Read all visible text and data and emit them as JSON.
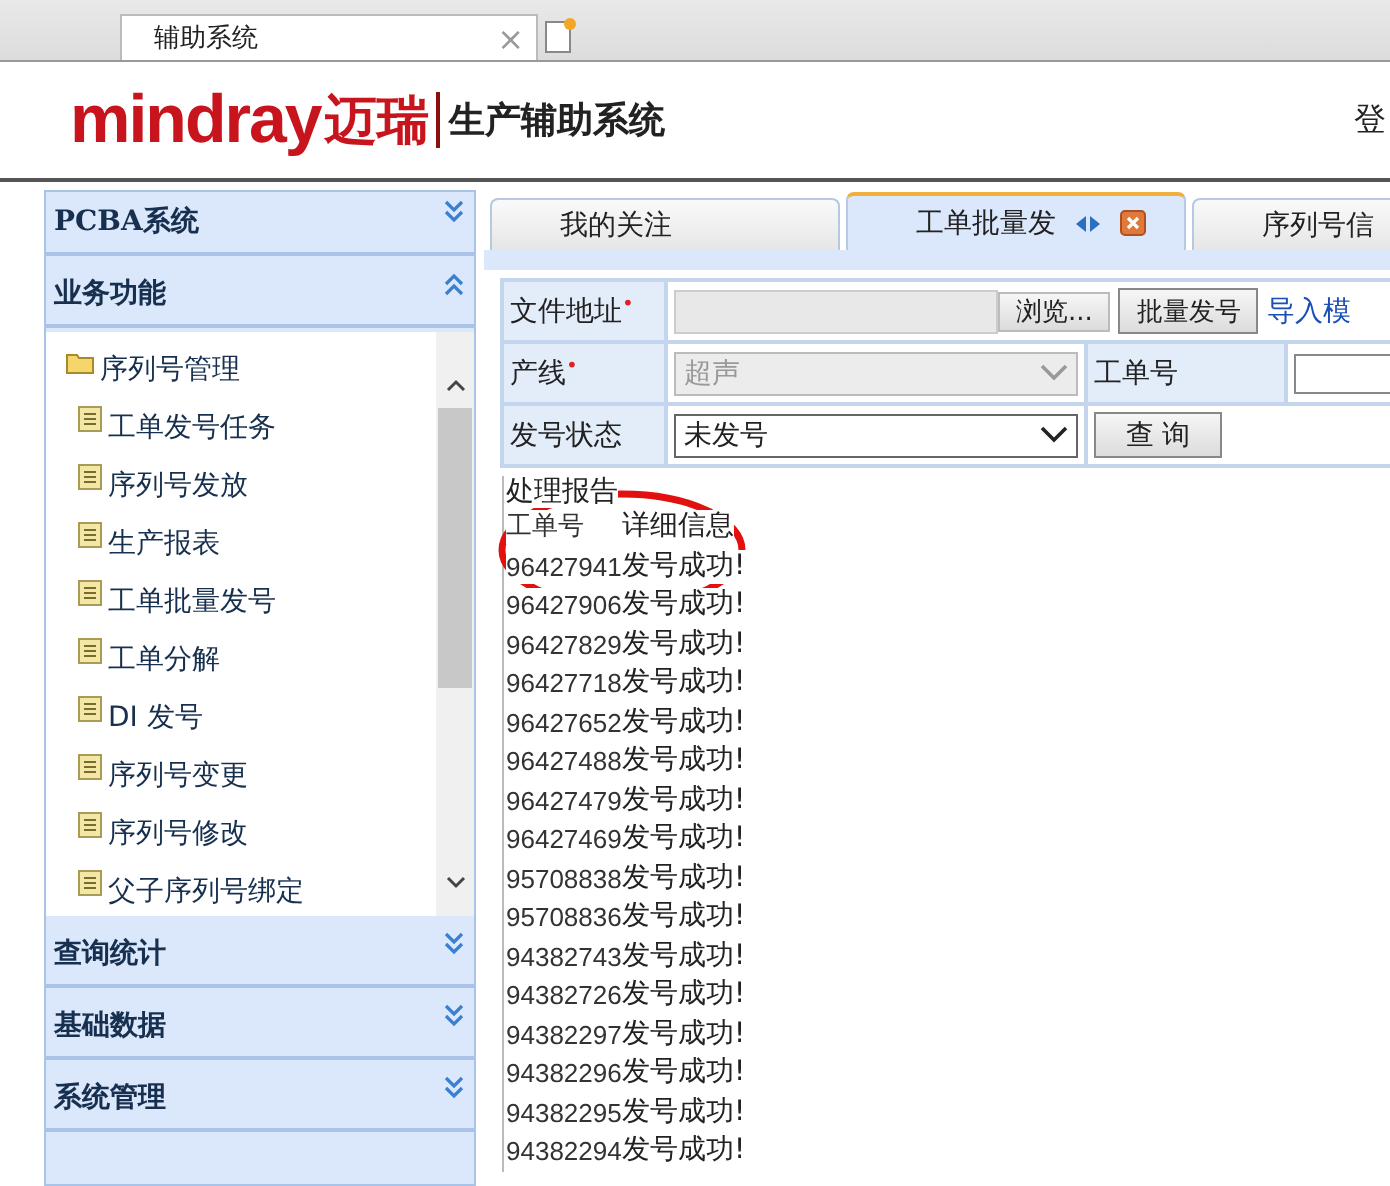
{
  "browser_tab": {
    "title": "辅助系统",
    "close": "×"
  },
  "header": {
    "logo": "mindray",
    "logo_cn": "迈瑞",
    "system_title": "生产辅助系统",
    "login": "登"
  },
  "sidebar": {
    "sections": [
      {
        "title": "PCBA系统",
        "expanded": false
      },
      {
        "title": "业务功能",
        "expanded": true,
        "items": [
          {
            "label": "序列号管理",
            "kind": "folder",
            "children": [
              {
                "label": "工单发号任务",
                "kind": "page"
              },
              {
                "label": "序列号发放",
                "kind": "page"
              },
              {
                "label": "生产报表",
                "kind": "page"
              },
              {
                "label": "工单批量发号",
                "kind": "page"
              },
              {
                "label": "工单分解",
                "kind": "page"
              },
              {
                "label": "DI 发号",
                "kind": "page"
              },
              {
                "label": "序列号变更",
                "kind": "page"
              },
              {
                "label": "序列号修改",
                "kind": "page"
              },
              {
                "label": "父子序列号绑定",
                "kind": "page"
              }
            ]
          }
        ]
      },
      {
        "title": "查询统计",
        "expanded": false
      },
      {
        "title": "基础数据",
        "expanded": false
      },
      {
        "title": "系统管理",
        "expanded": false
      }
    ]
  },
  "tabs": [
    {
      "label": "我的关注",
      "selected": false
    },
    {
      "label": "工单批量发",
      "selected": true
    },
    {
      "label": "序列号信",
      "selected": false
    }
  ],
  "form": {
    "file_label": "文件地址",
    "file_required_mark": "•",
    "browse_button": "浏览...",
    "batch_button": "批量发号",
    "import_link": "导入模",
    "line_label": "产线",
    "line_required_mark": "•",
    "line_value": "超声",
    "line_disabled": true,
    "order_label": "工单号",
    "status_label": "发号状态",
    "status_value": "未发号",
    "query_button": "查 询"
  },
  "report": {
    "title": "处理报告",
    "columns": [
      "工单号",
      "详细信息"
    ],
    "rows": [
      {
        "order": "96427941",
        "message": "发号成功!"
      },
      {
        "order": "96427906",
        "message": "发号成功!"
      },
      {
        "order": "96427829",
        "message": "发号成功!"
      },
      {
        "order": "96427718",
        "message": "发号成功!"
      },
      {
        "order": "96427652",
        "message": "发号成功!"
      },
      {
        "order": "96427488",
        "message": "发号成功!"
      },
      {
        "order": "96427479",
        "message": "发号成功!"
      },
      {
        "order": "96427469",
        "message": "发号成功!"
      },
      {
        "order": "95708838",
        "message": "发号成功!"
      },
      {
        "order": "95708836",
        "message": "发号成功!"
      },
      {
        "order": "94382743",
        "message": "发号成功!"
      },
      {
        "order": "94382726",
        "message": "发号成功!"
      },
      {
        "order": "94382297",
        "message": "发号成功!"
      },
      {
        "order": "94382296",
        "message": "发号成功!"
      },
      {
        "order": "94382295",
        "message": "发号成功!"
      },
      {
        "order": "94382294",
        "message": "发号成功!"
      }
    ]
  }
}
